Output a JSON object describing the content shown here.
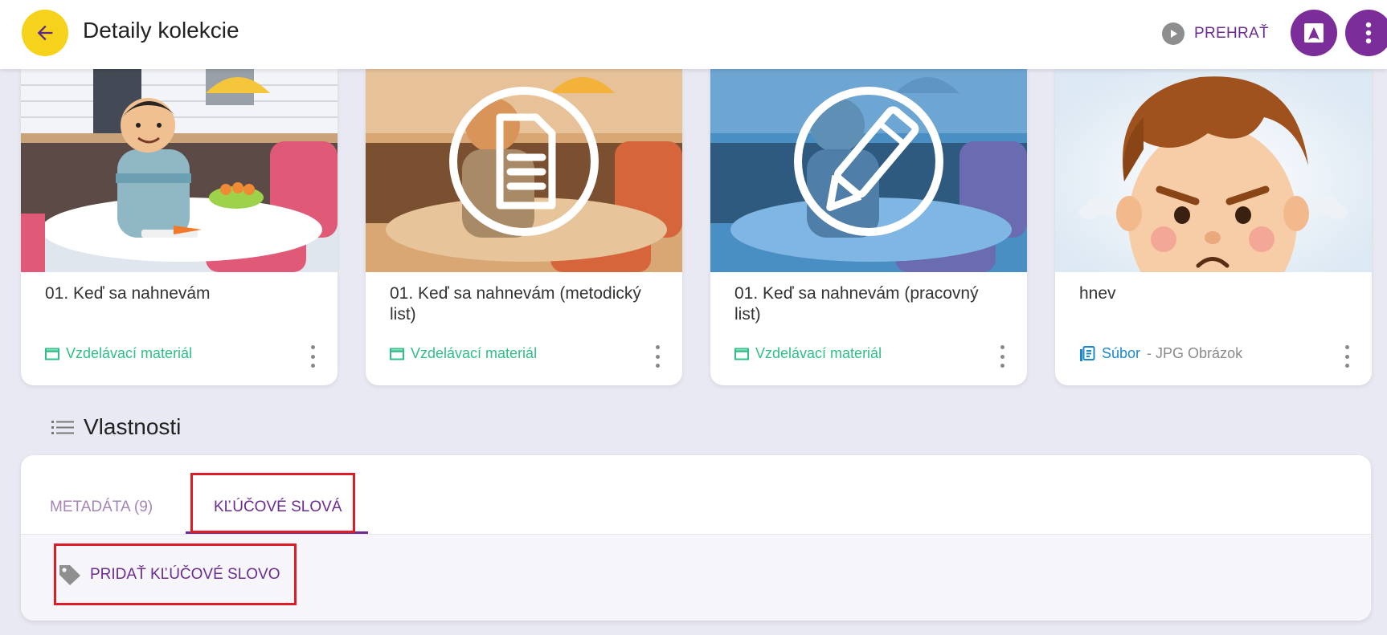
{
  "header": {
    "title": "Detaily kolekcie",
    "play_label": "PREHRAŤ",
    "icons": {
      "back": "arrow-left-icon",
      "play": "play-icon",
      "pdf": "pdf-icon",
      "more": "more-vertical-icon"
    }
  },
  "colors": {
    "accent": "#6b2b91",
    "back_button": "#f7d21a",
    "material_green": "#2fbf86",
    "file_blue": "#1b88c9",
    "highlight_red": "#dd1c28"
  },
  "cards": [
    {
      "title": "01. Keď sa nahnevám",
      "type_label": "Vzdelávací materiál",
      "icon": "calendar-outline-icon"
    },
    {
      "title": "01. Keď sa nahnevám (metodický list)",
      "type_label": "Vzdelávací materiál",
      "icon": "calendar-outline-icon",
      "overlay": "document-icon"
    },
    {
      "title": "01. Keď sa nahnevám (pracovný list)",
      "type_label": "Vzdelávací materiál",
      "icon": "calendar-outline-icon",
      "overlay": "pencil-icon"
    },
    {
      "title": "hnev",
      "type_label": "Súbor",
      "subtype": "- JPG Obrázok",
      "icon": "file-list-icon"
    }
  ],
  "properties": {
    "heading": "Vlastnosti",
    "tabs": [
      {
        "label": "METADÁTA (9)",
        "active": false
      },
      {
        "label": "KĽÚČOVÉ SLOVÁ",
        "active": true
      }
    ],
    "add_keyword_label": "PRIDAŤ KĽÚČOVÉ SLOVO"
  }
}
